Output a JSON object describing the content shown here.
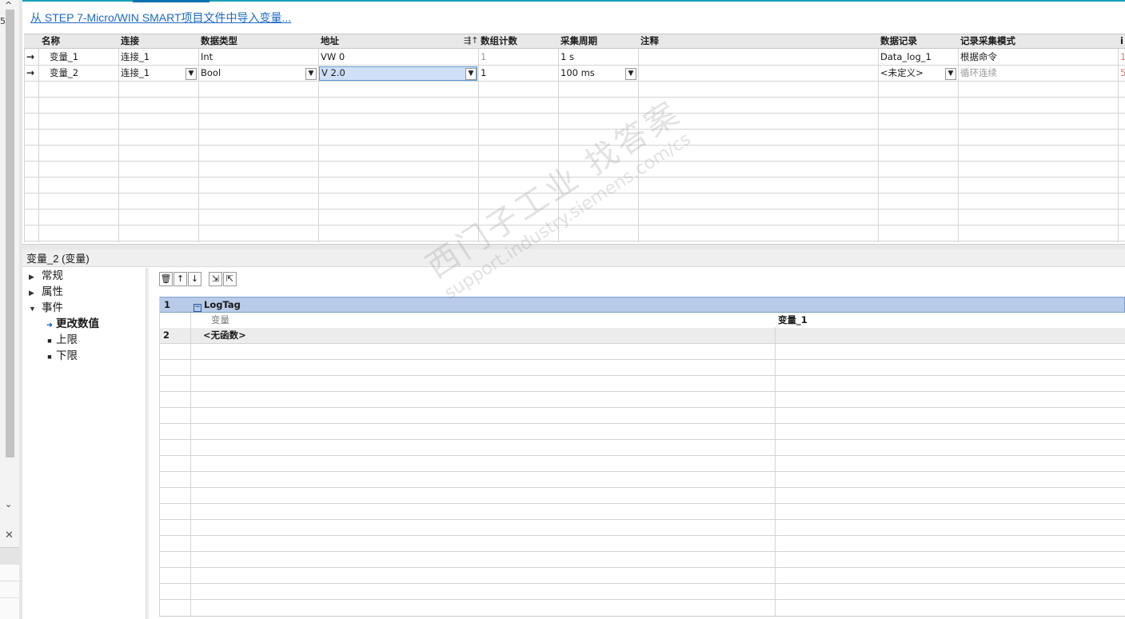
{
  "import_link": "从 STEP 7-Micro/WIN SMART项目文件中导入变量...",
  "left_strip": {
    "partial_text": "5"
  },
  "table": {
    "columns": [
      "名称",
      "连接",
      "数据类型",
      "地址",
      "数组计数",
      "采集周期",
      "注释",
      "数据记录",
      "记录采集模式",
      "i"
    ],
    "rows": [
      {
        "name": "变量_1",
        "connection": "连接_1",
        "datatype": "Int",
        "address": "VW 0",
        "count": "1",
        "cycle": "1 s",
        "comment": "",
        "log": "Data_log_1",
        "mode": "根据命令",
        "extra": "1"
      },
      {
        "name": "变量_2",
        "connection": "连接_1",
        "datatype": "Bool",
        "address": "V 2.0",
        "count": "1",
        "cycle": "100 ms",
        "comment": "",
        "log": "<未定义>",
        "mode": "循环连续",
        "extra": "5"
      }
    ]
  },
  "props": {
    "title": "变量_2 (变量)",
    "nav": [
      "常规",
      "属性",
      "事件",
      "更改数值",
      "上限",
      "下限"
    ]
  },
  "functions": {
    "rows": [
      {
        "num": "1",
        "name": "LogTag",
        "param_label": "变量",
        "param_value": "变量_1"
      },
      {
        "num": "2",
        "name": "<无函数>"
      }
    ]
  },
  "watermark": {
    "line1": "西门子工业  找答案",
    "line2": "support.industry.siemens.com/cs"
  },
  "colors": {
    "accent": "#1a9fb8",
    "link": "#1c69c4",
    "selection": "#cfe0f7",
    "group_row": "#b8cbe8"
  }
}
